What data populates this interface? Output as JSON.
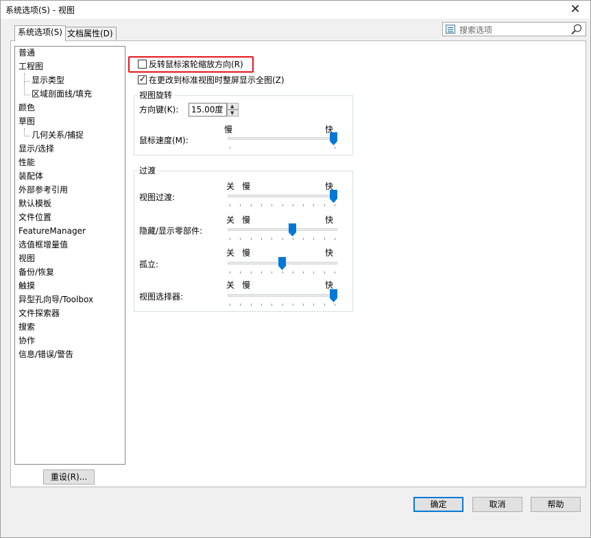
{
  "window": {
    "title": "系统选项(S) - 视图",
    "close_glyph": "✕"
  },
  "tabs": [
    {
      "label": "系统选项(S)",
      "active": true
    },
    {
      "label": "文档属性(D)",
      "active": false
    }
  ],
  "search": {
    "placeholder": "搜索选项"
  },
  "tree": {
    "items": [
      {
        "label": "普通",
        "level": 0
      },
      {
        "label": "工程图",
        "level": 0
      },
      {
        "label": "显示类型",
        "level": 1
      },
      {
        "label": "区域剖面线/填充",
        "level": 1
      },
      {
        "label": "颜色",
        "level": 0
      },
      {
        "label": "草图",
        "level": 0
      },
      {
        "label": "几何关系/捕捉",
        "level": 1
      },
      {
        "label": "显示/选择",
        "level": 0
      },
      {
        "label": "性能",
        "level": 0
      },
      {
        "label": "装配体",
        "level": 0
      },
      {
        "label": "外部参考引用",
        "level": 0
      },
      {
        "label": "默认模板",
        "level": 0
      },
      {
        "label": "文件位置",
        "level": 0
      },
      {
        "label": "FeatureManager",
        "level": 0
      },
      {
        "label": "选值框增量值",
        "level": 0
      },
      {
        "label": "视图",
        "level": 0,
        "selected": true
      },
      {
        "label": "备份/恢复",
        "level": 0
      },
      {
        "label": "触摸",
        "level": 0
      },
      {
        "label": "异型孔向导/Toolbox",
        "level": 0
      },
      {
        "label": "文件探索器",
        "level": 0
      },
      {
        "label": "搜索",
        "level": 0
      },
      {
        "label": "协作",
        "level": 0
      },
      {
        "label": "信息/错误/警告",
        "level": 0
      }
    ]
  },
  "reset_button": "重设(R)...",
  "options": {
    "reverse_wheel": {
      "label": "反转鼠标滚轮缩放方向(R)",
      "checked": false
    },
    "zoom_to_fit": {
      "label": "在更改到标准视图时整屏显示全图(Z)",
      "checked": true
    }
  },
  "view_rotation": {
    "title": "视图旋转",
    "arrow_keys_label": "方向键(K):",
    "arrow_keys_value": "15.00度",
    "mouse_speed_label": "鼠标速度(M):",
    "slow": "慢",
    "fast": "快",
    "mouse_speed_level": 1.0
  },
  "transitions": {
    "title": "过渡",
    "off": "关",
    "slow": "慢",
    "fast": "快",
    "sliders": [
      {
        "label": "视图过渡:",
        "level": 1.0
      },
      {
        "label": "隐藏/显示零部件:",
        "level": 0.6
      },
      {
        "label": "孤立:",
        "level": 0.5
      },
      {
        "label": "视图选择器:",
        "level": 1.0
      }
    ]
  },
  "footer": {
    "ok": "确定",
    "cancel": "取消",
    "help": "帮助"
  },
  "colors": {
    "accent": "#0078d7",
    "highlight": "#e4141b"
  }
}
